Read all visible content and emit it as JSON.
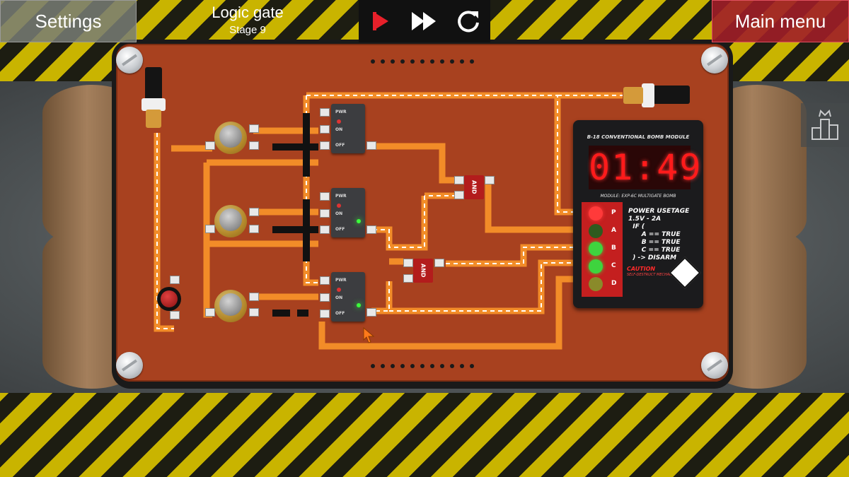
{
  "header": {
    "settings_label": "Settings",
    "title": "Logic gate",
    "stage": "Stage 9",
    "main_menu_label": "Main menu"
  },
  "controls": [
    {
      "icon": "play-icon",
      "color": "#e8202a"
    },
    {
      "icon": "fast-forward-icon",
      "color": "#ffffff"
    },
    {
      "icon": "restart-icon",
      "color": "#ffffff"
    }
  ],
  "side": {
    "icon": "leaderboard-icon"
  },
  "gate_labels": {
    "pwr": "PWR",
    "on": "ON",
    "off": "OFF"
  },
  "gates": [
    {
      "name": "gate-1",
      "pwr_led": "#d33",
      "on_led": "none"
    },
    {
      "name": "gate-2",
      "pwr_led": "#d33",
      "on_led": "#3bff3b"
    },
    {
      "name": "gate-3",
      "pwr_led": "#d33",
      "on_led": "#3bff3b"
    }
  ],
  "and_gates": [
    {
      "label": "AND"
    },
    {
      "label": "AND"
    }
  ],
  "module": {
    "title": "B-18 CONVENTIONAL BOMB MODULE",
    "timer": "01:49",
    "subtitle": "MODULE: EXP-6C MULTIGATE BOMB",
    "status_lights": [
      {
        "letter": "P",
        "color": "#ff3a3a"
      },
      {
        "letter": "A",
        "color": "#2e5a1e"
      },
      {
        "letter": "B",
        "color": "#3ed43e"
      },
      {
        "letter": "C",
        "color": "#3ed43e"
      },
      {
        "letter": "D",
        "color": "#8a8a2a"
      }
    ],
    "rules": "POWER USETAGE\n1.5V - 2A\n  IF (\n      A == TRUE\n      B == TRUE\n      C == TRUE\n  ) -> DISARM",
    "caution": "CAUTION",
    "caution_sub": "SELF-DESTRUCT MECHANISM"
  },
  "colors": {
    "wire": "#f28c28",
    "board": "#a8411f",
    "accent_red": "#c41f1f"
  }
}
